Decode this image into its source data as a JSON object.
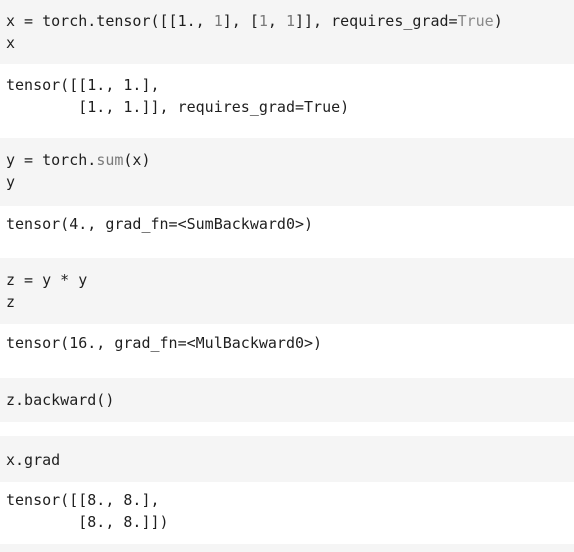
{
  "cells": {
    "c1_in": {
      "l1_a": "x = torch.tensor([[1., ",
      "l1_n1": "1",
      "l1_b": "], [",
      "l1_n2": "1",
      "l1_c": ", ",
      "l1_n3": "1",
      "l1_d": "]], requires_grad=",
      "l1_true": "True",
      "l1_e": ")",
      "l2": "x"
    },
    "c1_out": {
      "l1": "tensor([[1., 1.],",
      "l2": "        [1., 1.]], requires_grad=True)"
    },
    "c2_in": {
      "l1_a": "y = torch.",
      "l1_fn": "sum",
      "l1_b": "(x)",
      "l2": "y"
    },
    "c2_out": {
      "l1": "tensor(4., grad_fn=<SumBackward0>)"
    },
    "c3_in": {
      "l1": "z = y * y",
      "l2": "z"
    },
    "c3_out": {
      "l1": "tensor(16., grad_fn=<MulBackward0>)"
    },
    "c4_in": {
      "l1": "z.backward()"
    },
    "c5_in": {
      "l1": "x.grad"
    },
    "c5_out": {
      "l1": "tensor([[8., 8.],",
      "l2": "        [8., 8.]])"
    }
  }
}
